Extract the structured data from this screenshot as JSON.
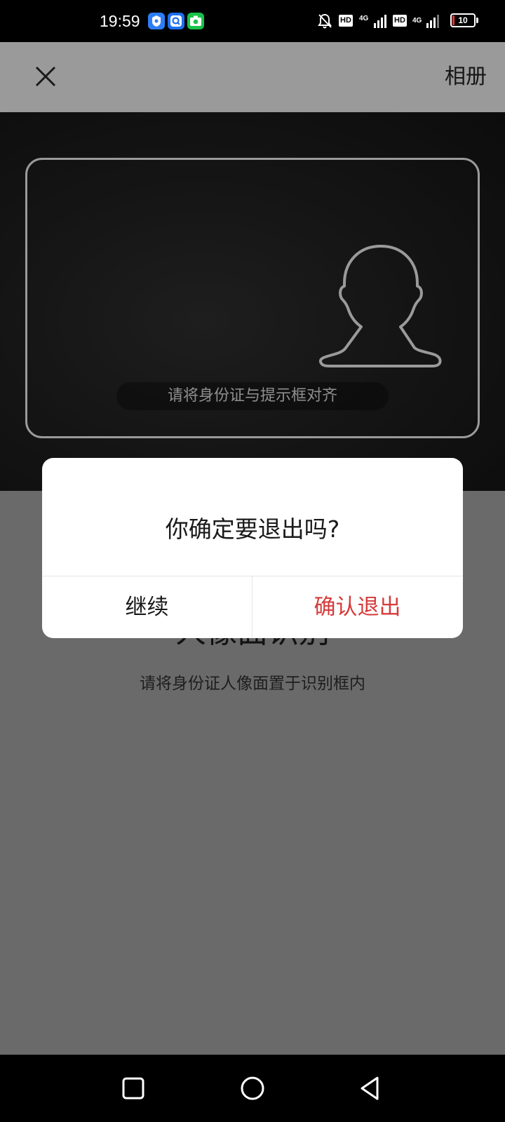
{
  "status_bar": {
    "time": "19:59",
    "hd_badge_1": "HD",
    "network_1": "4G",
    "hd_badge_2": "HD",
    "network_2": "4G",
    "battery_level": "10",
    "battery_fraction": 0.1,
    "battery_color": "#e33333"
  },
  "app_bar": {
    "album_label": "相册"
  },
  "camera": {
    "frame_hint": "请将身份证与提示框对齐"
  },
  "section": {
    "title": "人像面识别",
    "subtitle": "请将身份证人像面置于识别框内"
  },
  "dialog": {
    "message": "你确定要退出吗?",
    "continue_label": "继续",
    "confirm_exit_label": "确认退出",
    "confirm_color": "#d63a3a"
  },
  "icons": {
    "close": "close-icon",
    "portrait": "portrait-silhouette-icon",
    "nav_recents": "square-icon",
    "nav_home": "circle-icon",
    "nav_back": "triangle-back-icon"
  }
}
